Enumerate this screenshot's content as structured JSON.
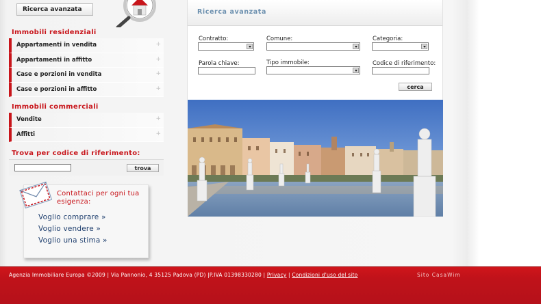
{
  "sidebar": {
    "advanced_search_button": "Ricerca avanzata",
    "residential": {
      "title": "Immobili residenziali",
      "items": [
        {
          "label": "Appartamenti in vendita"
        },
        {
          "label": "Appartamenti in affitto"
        },
        {
          "label": "Case e porzioni in vendita"
        },
        {
          "label": "Case e porzioni in affitto"
        }
      ]
    },
    "commercial": {
      "title": "Immobili commerciali",
      "items": [
        {
          "label": "Vendite"
        },
        {
          "label": "Affitti"
        }
      ]
    },
    "code_search": {
      "title": "Trova per codice di riferimento:",
      "input_value": "",
      "button": "trova"
    },
    "contact": {
      "title": "Contattaci per ogni tua esigenza:",
      "links": [
        {
          "label": "Voglio comprare »"
        },
        {
          "label": "Voglio vendere »"
        },
        {
          "label": "Voglio una stima »"
        }
      ]
    }
  },
  "main": {
    "panel_title": "Ricerca avanzata",
    "fields": {
      "contratto": {
        "label": "Contratto:",
        "value": ""
      },
      "comune": {
        "label": "Comune:",
        "value": ""
      },
      "categoria": {
        "label": "Categoria:",
        "value": ""
      },
      "parola_chiave": {
        "label": "Parola chiave:",
        "value": ""
      },
      "tipo_immobile": {
        "label": "Tipo immobile:",
        "value": ""
      },
      "codice_riferimento": {
        "label": "Codice di riferimento:",
        "value": ""
      }
    },
    "search_button": "cerca"
  },
  "footer": {
    "company": "Agenzia Immobiliare Europa ©2009 | Via Pannonio, 4 35125 Padova (PD) |P.IVA 01398330280 |",
    "privacy_link": "Privacy",
    "separator": "|",
    "terms_link": "Condizioni d'uso del sito",
    "site_link": "Sito CasaWim"
  },
  "colors": {
    "accent": "#c8151b",
    "panel_title": "#6b8fae",
    "link": "#1f3f6e",
    "footer_bg": "#c0121a"
  }
}
